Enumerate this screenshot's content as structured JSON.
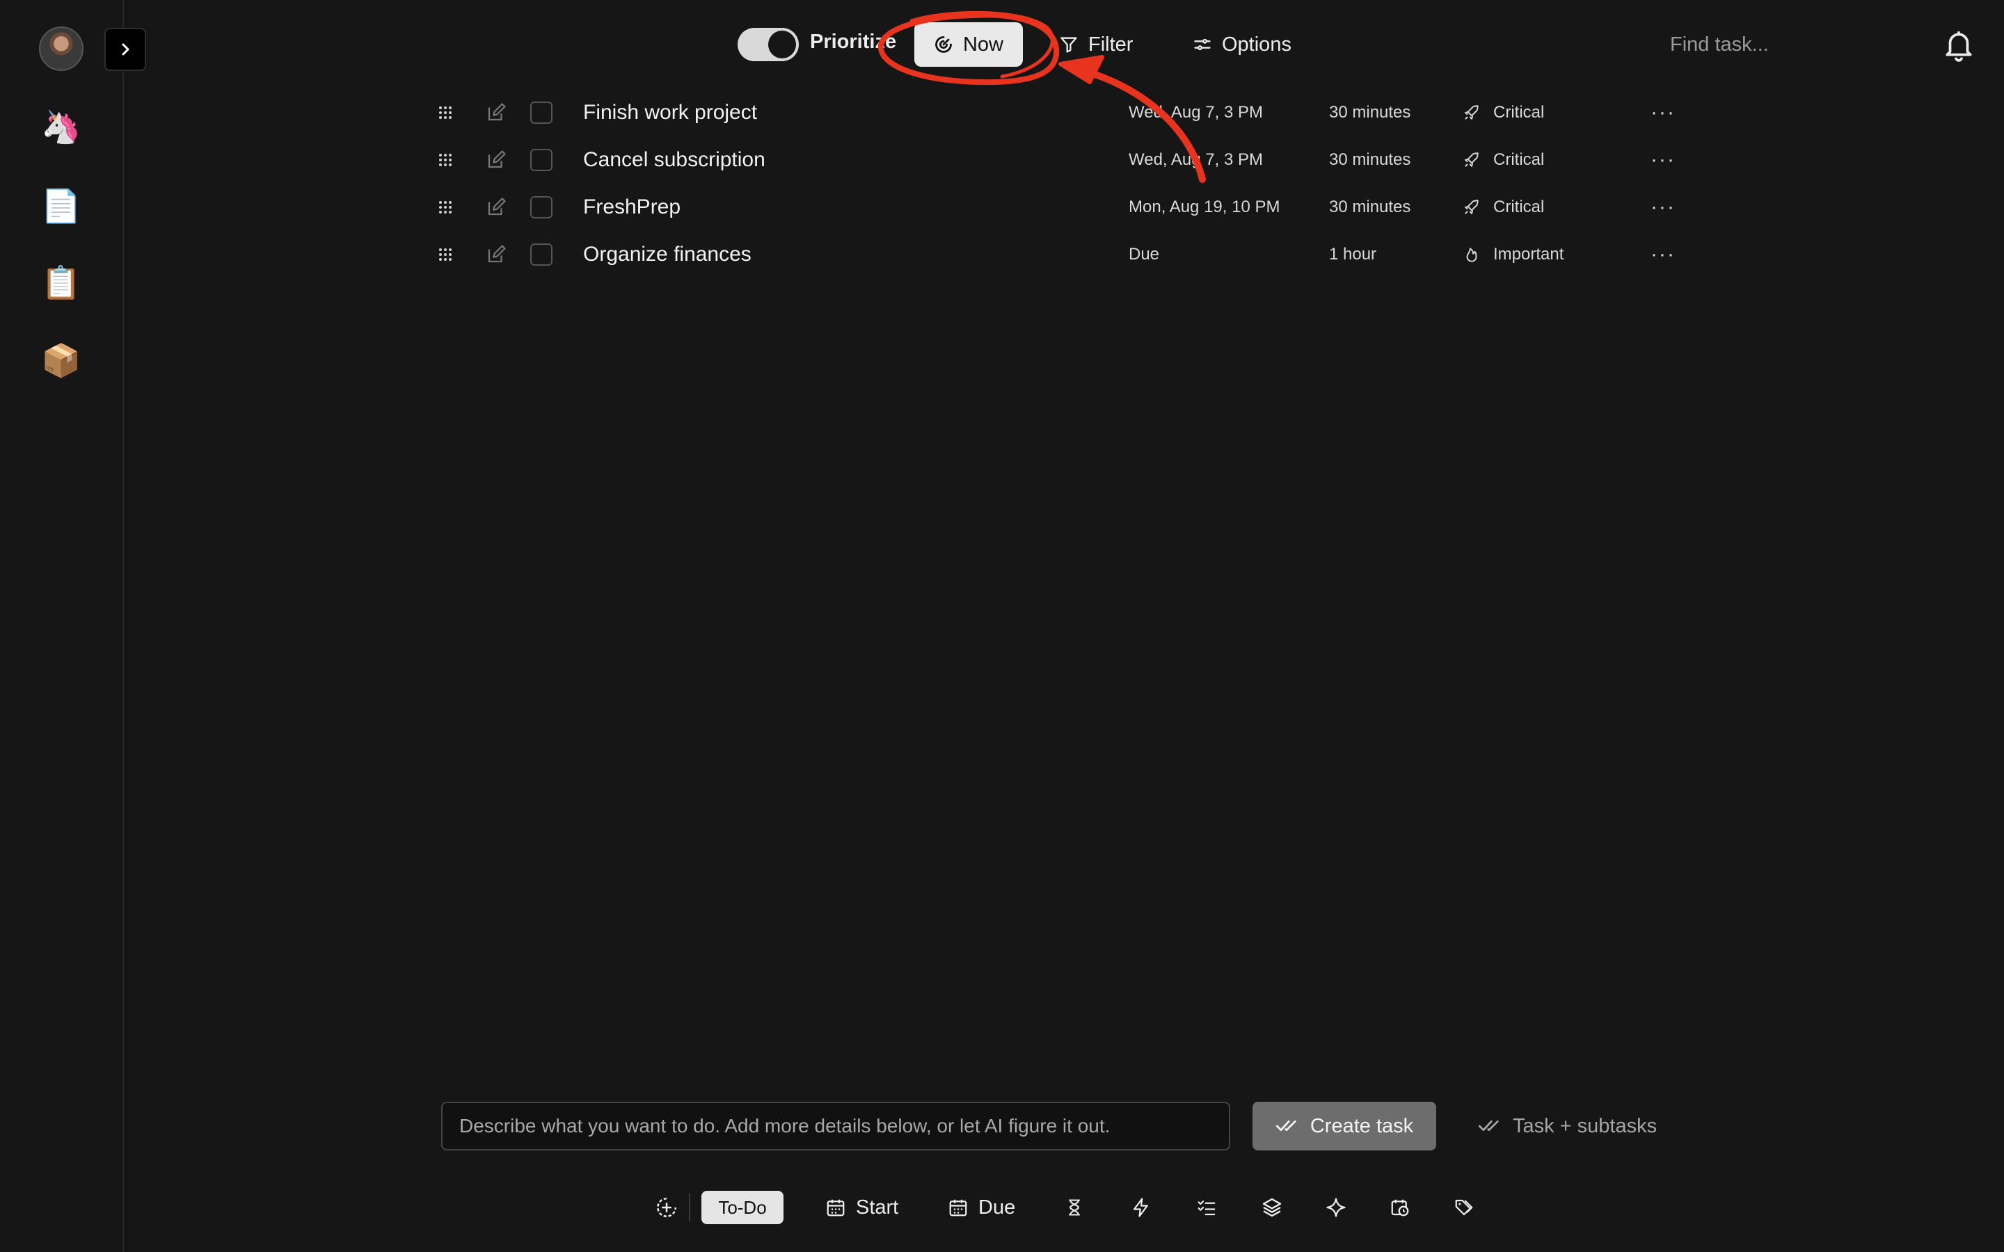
{
  "sidebar": {
    "expand_icon": "chevron-right-icon",
    "items": [
      {
        "name": "unicorn",
        "glyph": "🦄"
      },
      {
        "name": "page",
        "glyph": "📄"
      },
      {
        "name": "clipboard",
        "glyph": "📋"
      },
      {
        "name": "package",
        "glyph": "📦"
      }
    ]
  },
  "topbar": {
    "prioritize_label": "Prioritize",
    "now_label": "Now",
    "filter_label": "Filter",
    "options_label": "Options",
    "search_placeholder": "Find task..."
  },
  "tasks": [
    {
      "title": "Finish work project",
      "date": "Wed, Aug 7, 3 PM",
      "duration": "30 minutes",
      "priority": "Critical",
      "priority_icon": "rocket-icon"
    },
    {
      "title": "Cancel subscription",
      "date": "Wed, Aug 7, 3 PM",
      "duration": "30 minutes",
      "priority": "Critical",
      "priority_icon": "rocket-icon"
    },
    {
      "title": "FreshPrep",
      "date": "Mon, Aug 19, 10 PM",
      "duration": "30 minutes",
      "priority": "Critical",
      "priority_icon": "rocket-icon"
    },
    {
      "title": "Organize finances",
      "date": "Due",
      "duration": "1 hour",
      "priority": "Important",
      "priority_icon": "flame-icon"
    }
  ],
  "composer": {
    "placeholder": "Describe what you want to do. Add more details below, or let AI figure it out.",
    "create_label": "Create task",
    "subtasks_label": "Task + subtasks"
  },
  "toolbar": {
    "todo_label": "To-Do",
    "start_label": "Start",
    "due_label": "Due"
  },
  "colors": {
    "background": "#161616",
    "annotation": "#e8331f"
  }
}
